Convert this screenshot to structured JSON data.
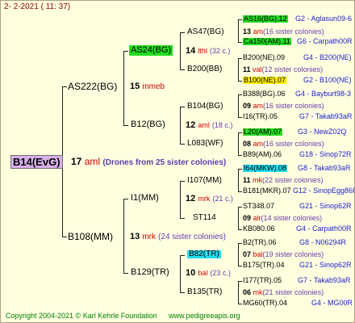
{
  "header": {
    "date": "2-  2-2021 ( 11: 37)"
  },
  "footer": {
    "copyright": "Copyright 2004-2021 © Karl Kehrle Foundation",
    "site": "www.pedigreeapis.org"
  },
  "root": {
    "name": "B14(EvG)",
    "number": "17",
    "abbr": "aml",
    "note": "(Drones from 25 sister colonies)"
  },
  "g1": [
    {
      "name": "AS222(BG)",
      "number": "15",
      "abbr": "mmeb"
    },
    {
      "name": "B108(MM)",
      "number": "13",
      "abbr": "mrk",
      "note": "(24 sister colonies)"
    }
  ],
  "g2": [
    {
      "name": "AS24(BG)",
      "number": "14",
      "abbr": "lthl",
      "note": "(32 c.)"
    },
    {
      "name": "B12(BG)",
      "number": "12",
      "abbr": "aml",
      "note": "(18 c.)"
    },
    {
      "name": "I1(MM)",
      "number": "12",
      "abbr": "mrk",
      "note": "(21 c.)"
    },
    {
      "name": "B129(TR)",
      "number": "10",
      "abbr": "bal",
      "note": "(23 c.)"
    }
  ],
  "g3": [
    {
      "name": "AS47(BG)",
      "number": "13",
      "abbr": "am",
      "note": "(16 sister colonies)"
    },
    {
      "name": "B200(BB)",
      "number": "11",
      "abbr": "val",
      "note": "(12 sister colonies)"
    },
    {
      "name": "B104(BG)",
      "number": "09",
      "abbr": "am",
      "note": "(16 sister colonies)"
    },
    {
      "name": "L083(WF)",
      "number": "08",
      "abbr": "am",
      "note": "(16 sister colonies)"
    },
    {
      "name": "I107(MM)",
      "number": "11",
      "abbr": "mk",
      "note": "(22 sister colonies)"
    },
    {
      "name": "ST114",
      "number": "09",
      "abbr": "alr",
      "note": "(14 sister colonies)"
    },
    {
      "name": "B82(TR)",
      "number": "07",
      "abbr": "bal",
      "note": "(19 sister colonies)"
    },
    {
      "name": "B135(TR)",
      "number": "06",
      "abbr": "mk",
      "note": "(21 sister colonies)"
    }
  ],
  "g4": [
    {
      "name": "AS16(BG).12",
      "ref": "G2 - Aglasun09-6"
    },
    {
      "name": "Ca150(AM).11",
      "ref": "G6 - Carpath00R"
    },
    {
      "name": "B200(NE).09",
      "ref": "G4 - B200(NE)"
    },
    {
      "name": "B100(NE).07",
      "ref": "G2 - B100(NE)"
    },
    {
      "name": "B388(BG).06",
      "ref": "G4 - Bayburt98-3"
    },
    {
      "name": "I16(TR).05",
      "ref": "G7 - Takab93aR"
    },
    {
      "name": "L20(AM).07",
      "ref": "G3 - NewZ02Q"
    },
    {
      "name": "B89(AM).06",
      "ref": "G18 - Sinop72R"
    },
    {
      "name": "I64(MKW).08",
      "ref": "G8 - Takab93aR"
    },
    {
      "name": "B181(MKR).07",
      "ref": "G12 - SinopEgg86R"
    },
    {
      "name": "ST348.07",
      "ref": "G21 - Sinop62R"
    },
    {
      "name": "KB080.06",
      "ref": "G4 - Carpath00R"
    },
    {
      "name": "B2(TR).06",
      "ref": "G8 - N06294R"
    },
    {
      "name": "B175(TR).04",
      "ref": "G21 - Sinop62R"
    },
    {
      "name": "I177(TR).05",
      "ref": "G7 - Takab93aR"
    },
    {
      "name": "MG60(TR).04",
      "ref": "G4 - MG00R"
    }
  ]
}
